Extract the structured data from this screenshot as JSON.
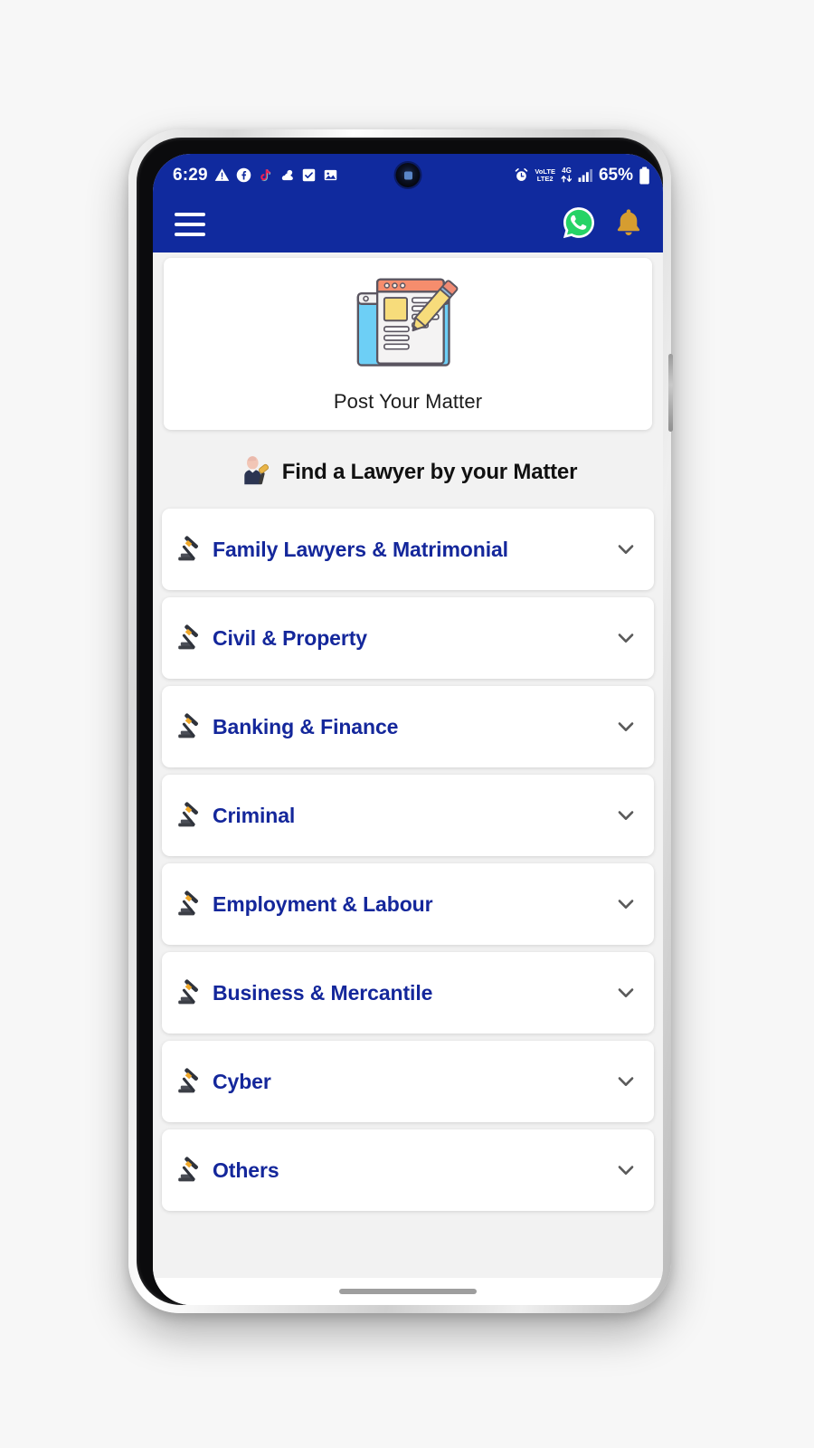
{
  "status_bar": {
    "time": "6:29",
    "left_icons": [
      "warning-triangle-icon",
      "facebook-icon",
      "tiktok-icon",
      "weather-icon",
      "tasks-icon",
      "gallery-icon"
    ],
    "camera": "punch-hole-camera",
    "alarm_icon": "alarm-clock-icon",
    "volte_label": "VoLTE2",
    "volte_top": "VoLTE",
    "volte_bottom": "LTE2",
    "network_top": "4G",
    "signal_icon": "signal-bars-icon",
    "battery_percent": "65%",
    "battery_icon": "battery-icon"
  },
  "app_bar": {
    "menu_icon": "hamburger-menu-icon",
    "whatsapp_icon": "whatsapp-icon",
    "notification_icon": "bell-icon",
    "background_color": "#102a9e"
  },
  "post_matter": {
    "label": "Post Your Matter",
    "illustration": "document-with-pencil-illustration"
  },
  "find_lawyer": {
    "title": "Find a Lawyer by your Matter",
    "icon": "judge-emoji-icon"
  },
  "categories": [
    {
      "label": "Family Lawyers & Matrimonial",
      "icon": "gavel-icon",
      "chevron": "chevron-down-icon"
    },
    {
      "label": "Civil & Property",
      "icon": "gavel-icon",
      "chevron": "chevron-down-icon"
    },
    {
      "label": "Banking & Finance",
      "icon": "gavel-icon",
      "chevron": "chevron-down-icon"
    },
    {
      "label": "Criminal",
      "icon": "gavel-icon",
      "chevron": "chevron-down-icon"
    },
    {
      "label": "Employment & Labour",
      "icon": "gavel-icon",
      "chevron": "chevron-down-icon"
    },
    {
      "label": "Business & Mercantile",
      "icon": "gavel-icon",
      "chevron": "chevron-down-icon"
    },
    {
      "label": "Cyber",
      "icon": "gavel-icon",
      "chevron": "chevron-down-icon"
    },
    {
      "label": "Others",
      "icon": "gavel-icon",
      "chevron": "chevron-down-icon"
    }
  ],
  "navigation": {
    "gesture_pill": "gesture-navigation-pill"
  },
  "colors": {
    "primary_blue": "#102a9e",
    "category_text": "#14279b",
    "whatsapp_green": "#25d366",
    "bell_gold": "#d69d30",
    "page_background": "#f2f2f2",
    "card_background": "#ffffff"
  }
}
